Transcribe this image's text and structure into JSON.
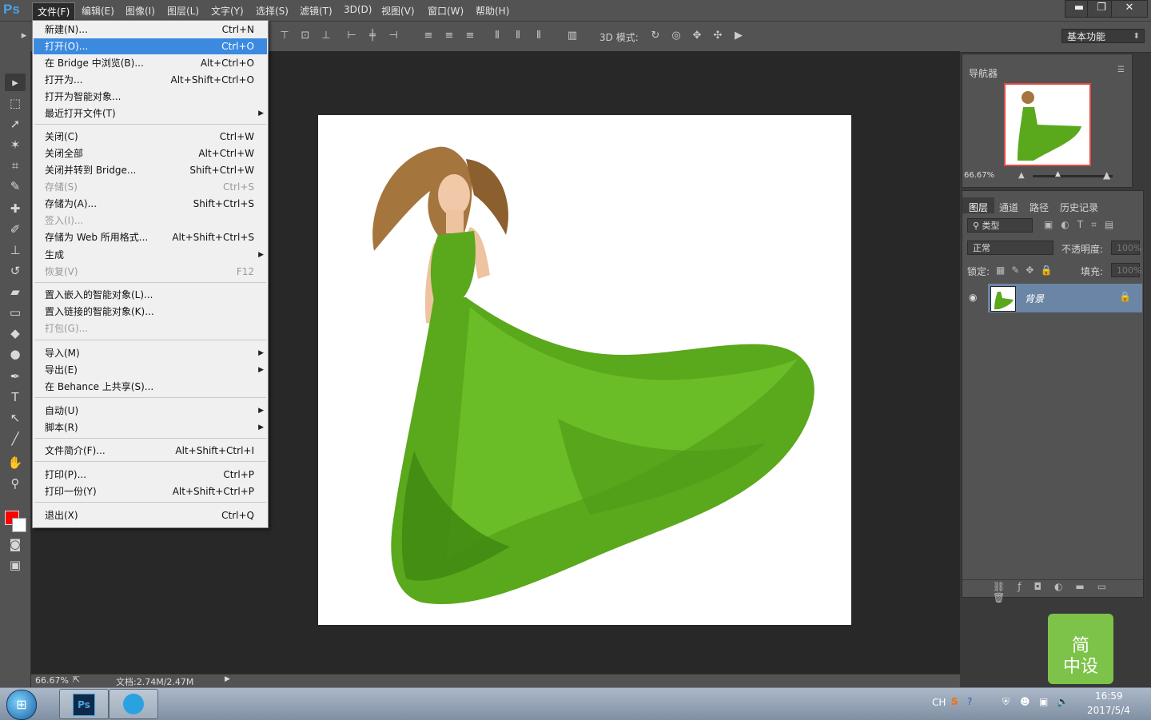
{
  "menubar": {
    "logo": "Ps",
    "items": [
      "文件(F)",
      "编辑(E)",
      "图像(I)",
      "图层(L)",
      "文字(Y)",
      "选择(S)",
      "滤镜(T)",
      "3D(D)",
      "视图(V)",
      "窗口(W)",
      "帮助(H)"
    ],
    "window_buttons": {
      "minimize": "▬",
      "restore": "❐",
      "close": "✕"
    }
  },
  "options_bar": {
    "mode_label": "3D 模式:",
    "workspace": "基本功能"
  },
  "file_menu": [
    {
      "label": "新建(N)...",
      "shortcut": "Ctrl+N"
    },
    {
      "label": "打开(O)...",
      "shortcut": "Ctrl+O",
      "highlighted": true
    },
    {
      "label": "在 Bridge 中浏览(B)...",
      "shortcut": "Alt+Ctrl+O"
    },
    {
      "label": "打开为...",
      "shortcut": "Alt+Shift+Ctrl+O"
    },
    {
      "label": "打开为智能对象...",
      "shortcut": ""
    },
    {
      "label": "最近打开文件(T)",
      "shortcut": "",
      "submenu": true
    },
    {
      "label": "关闭(C)",
      "shortcut": "Ctrl+W"
    },
    {
      "label": "关闭全部",
      "shortcut": "Alt+Ctrl+W"
    },
    {
      "label": "关闭并转到 Bridge...",
      "shortcut": "Shift+Ctrl+W"
    },
    {
      "label": "存储(S)",
      "shortcut": "Ctrl+S",
      "disabled": true
    },
    {
      "label": "存储为(A)...",
      "shortcut": "Shift+Ctrl+S"
    },
    {
      "label": "签入(I)...",
      "shortcut": "",
      "disabled": true
    },
    {
      "label": "存储为 Web 所用格式...",
      "shortcut": "Alt+Shift+Ctrl+S"
    },
    {
      "label": "生成",
      "shortcut": "",
      "submenu": true
    },
    {
      "label": "恢复(V)",
      "shortcut": "F12",
      "disabled": true
    },
    {
      "label": "置入嵌入的智能对象(L)...",
      "shortcut": ""
    },
    {
      "label": "置入链接的智能对象(K)...",
      "shortcut": ""
    },
    {
      "label": "打包(G)...",
      "shortcut": "",
      "disabled": true
    },
    {
      "label": "导入(M)",
      "shortcut": "",
      "submenu": true
    },
    {
      "label": "导出(E)",
      "shortcut": "",
      "submenu": true
    },
    {
      "label": "在 Behance 上共享(S)...",
      "shortcut": ""
    },
    {
      "label": "自动(U)",
      "shortcut": "",
      "submenu": true
    },
    {
      "label": "脚本(R)",
      "shortcut": "",
      "submenu": true
    },
    {
      "label": "文件简介(F)...",
      "shortcut": "Alt+Shift+Ctrl+I"
    },
    {
      "label": "打印(P)...",
      "shortcut": "Ctrl+P"
    },
    {
      "label": "打印一份(Y)",
      "shortcut": "Alt+Shift+Ctrl+P"
    },
    {
      "label": "退出(X)",
      "shortcut": "Ctrl+Q"
    }
  ],
  "navigator": {
    "title": "导航器",
    "zoom": "66.67%"
  },
  "layers": {
    "tabs": [
      "图层",
      "通道",
      "路径",
      "历史记录"
    ],
    "kind_filter": "类型",
    "blend_mode": "正常",
    "opacity_label": "不透明度:",
    "opacity_value": "100%",
    "lock_label": "锁定:",
    "fill_label": "填充:",
    "fill_value": "100%",
    "items": [
      {
        "name": "背景"
      }
    ]
  },
  "status": {
    "zoom": "66.67%",
    "doc_info": "文档:2.74M/2.47M"
  },
  "colors": {
    "foreground": "#ff0000",
    "background": "#ffffff",
    "dress_green": "#5aa81c"
  },
  "badge": {
    "text": "简\n中设"
  },
  "taskbar": {
    "lang": "CH",
    "time": "16:59",
    "date": "2017/5/4"
  }
}
